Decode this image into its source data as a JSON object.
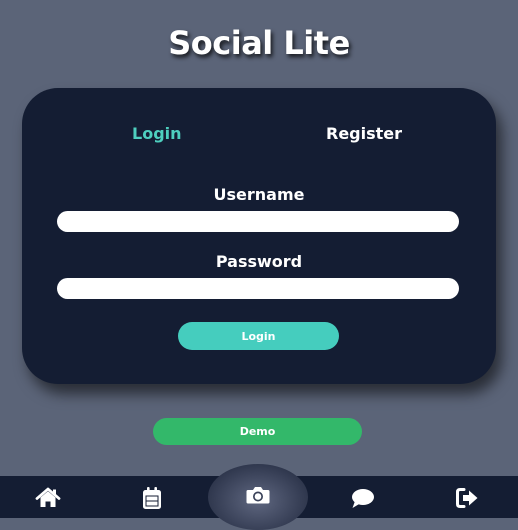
{
  "app": {
    "title": "Social Lite"
  },
  "auth_card": {
    "tabs": [
      {
        "label": "Login",
        "active": true
      },
      {
        "label": "Register",
        "active": false
      }
    ],
    "username_label": "Username",
    "username_value": "",
    "password_label": "Password",
    "password_value": "",
    "submit_label": "Login"
  },
  "demo_button": {
    "label": "Demo"
  },
  "bottom_nav": {
    "items": [
      {
        "icon": "home-icon"
      },
      {
        "icon": "calendar-icon"
      },
      {
        "icon": "camera-icon"
      },
      {
        "icon": "chat-icon"
      },
      {
        "icon": "logout-icon"
      }
    ]
  },
  "colors": {
    "background": "#5b6478",
    "card": "#141d33",
    "accent_teal": "#45cdbe",
    "active_tab": "#4ecfbf",
    "demo_green": "#33b86a",
    "text": "#ffffff"
  }
}
